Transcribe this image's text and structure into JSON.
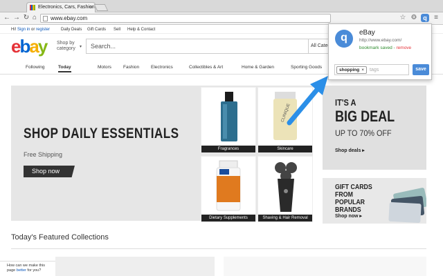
{
  "browser": {
    "tab_title": "Electronics, Cars, Fashion",
    "tab_close": "×",
    "url": "www.ebay.com",
    "nav": {
      "back": "←",
      "forward": "→",
      "reload": "↻",
      "home": "⌂"
    },
    "ext_icons": [
      "star-icon",
      "gear-icon",
      "q-extension-icon",
      "menu-icon"
    ],
    "ext_glyphs": {
      "star": "☆",
      "gear": "⚙",
      "q": "q",
      "menu": "≡"
    }
  },
  "ebay": {
    "util": {
      "greet": "Hi!",
      "sign_in": "Sign in",
      "or": "or",
      "register": "register",
      "daily_deals": "Daily Deals",
      "gift_cards": "Gift Cards",
      "sell": "Sell",
      "help": "Help & Contact"
    },
    "logo_letters": [
      "e",
      "b",
      "a",
      "y"
    ],
    "shop_by": "Shop by category",
    "shop_caret": "▾",
    "search_placeholder": "Search...",
    "category_select": "All Categ",
    "nav_items": [
      "Following",
      "Today",
      "Motors",
      "Fashion",
      "Electronics",
      "Collectibles & Art",
      "Home & Garden",
      "Sporting Goods"
    ],
    "hero": {
      "title": "SHOP DAILY ESSENTIALS",
      "subtitle": "Free Shipping",
      "button": "Shop now"
    },
    "tiles": [
      "Fragrances",
      "Skincare",
      "Dietary Supplements",
      "Shaving & Hair Removal"
    ],
    "promo1": {
      "line1": "IT'S A",
      "line2": "BIG DEAL",
      "line3": "UP TO 70% OFF",
      "cta": "Shop deals ▸"
    },
    "promo2": {
      "line1": "GIFT CARDS FROM POPULAR BRANDS",
      "cta": "Shop now ▸"
    },
    "featured_title": "Today's Featured Collections",
    "help": {
      "line1": "How can we make this",
      "line2_pre": "page",
      "better": "better",
      "line2_post": "for you?"
    }
  },
  "popup": {
    "avatar": "q",
    "title": "eBay",
    "url": "http://www.ebay.com/",
    "status": "bookmark saved",
    "separator": "-",
    "remove": "remove",
    "tag": "shopping",
    "tag_remove": "×",
    "tags_placeholder": "tags",
    "save": "save",
    "accent": "#4a8bd8"
  }
}
